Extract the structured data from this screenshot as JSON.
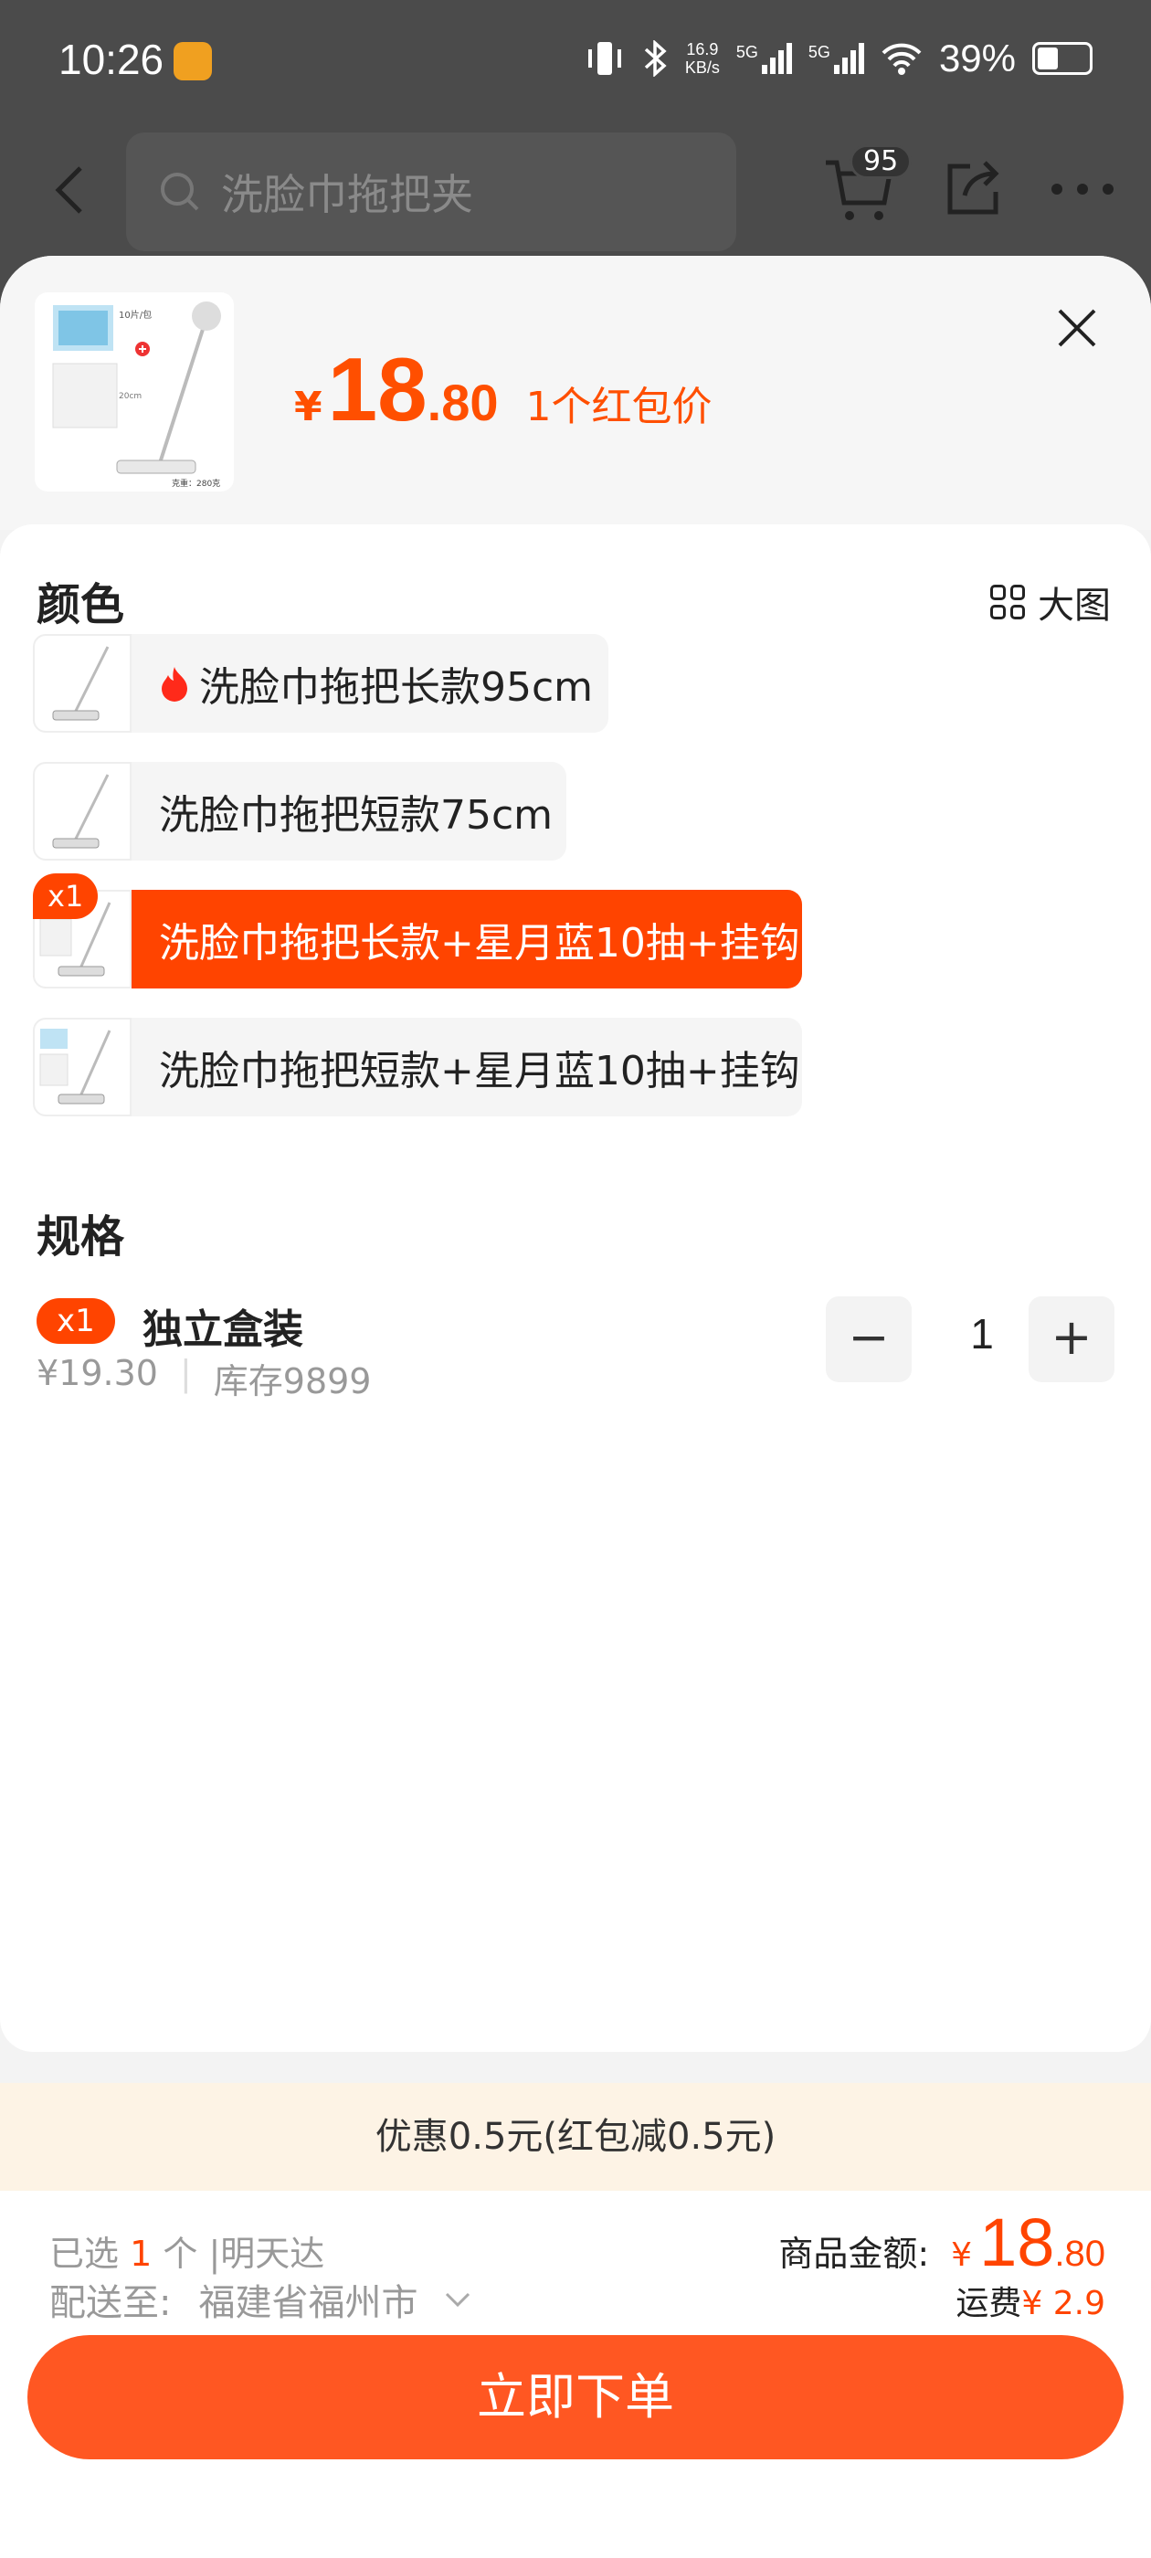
{
  "status": {
    "time": "10:26",
    "speed_top": "16.9",
    "speed_bottom": "KB/s",
    "net1": "5G",
    "net2": "5G",
    "battery": "39%"
  },
  "nav": {
    "search_placeholder": "洗脸巾拖把夹",
    "cart_count": "95"
  },
  "product": {
    "thumb_text1": "10片/包",
    "thumb_text2": "20cm",
    "thumb_text3": "克重：280克",
    "price_yen": "¥",
    "price_int": "18",
    "price_dec": ".80",
    "price_note": "1个红包价"
  },
  "color_section": {
    "title": "颜色",
    "big_image_label": "大图",
    "options": [
      {
        "label": "洗脸巾拖把长款95cm",
        "hot": true,
        "selected": false
      },
      {
        "label": "洗脸巾拖把短款75cm",
        "hot": false,
        "selected": false
      },
      {
        "label": "洗脸巾拖把长款+星月蓝10抽+挂钩",
        "hot": false,
        "selected": true,
        "tag": "x1"
      },
      {
        "label": "洗脸巾拖把短款+星月蓝10抽+挂钩",
        "hot": false,
        "selected": false
      }
    ]
  },
  "spec_section": {
    "title": "规格",
    "item": {
      "tag": "x1",
      "name": "独立盒装",
      "price": "¥19.30",
      "divider": "|",
      "stock": "库存9899"
    },
    "minus": "−",
    "quantity": "1",
    "plus": "+"
  },
  "promo": "优惠0.5元(红包减0.5元)",
  "footer": {
    "selected_prefix": "已选",
    "selected_count": "1",
    "selected_suffix": "个 |明天达",
    "ship_label": "配送至:",
    "ship_location": "福建省福州市",
    "amount_label": "商品金额:",
    "amount_yen": "¥",
    "amount_int": "18",
    "amount_dec": ".80",
    "freight_label": "运费",
    "freight_value": "¥ 2.9",
    "order_button": "立即下单"
  },
  "colors": {
    "accent": "#ff4400",
    "button": "#ff5722",
    "promo_bg": "#fdf3e5"
  }
}
